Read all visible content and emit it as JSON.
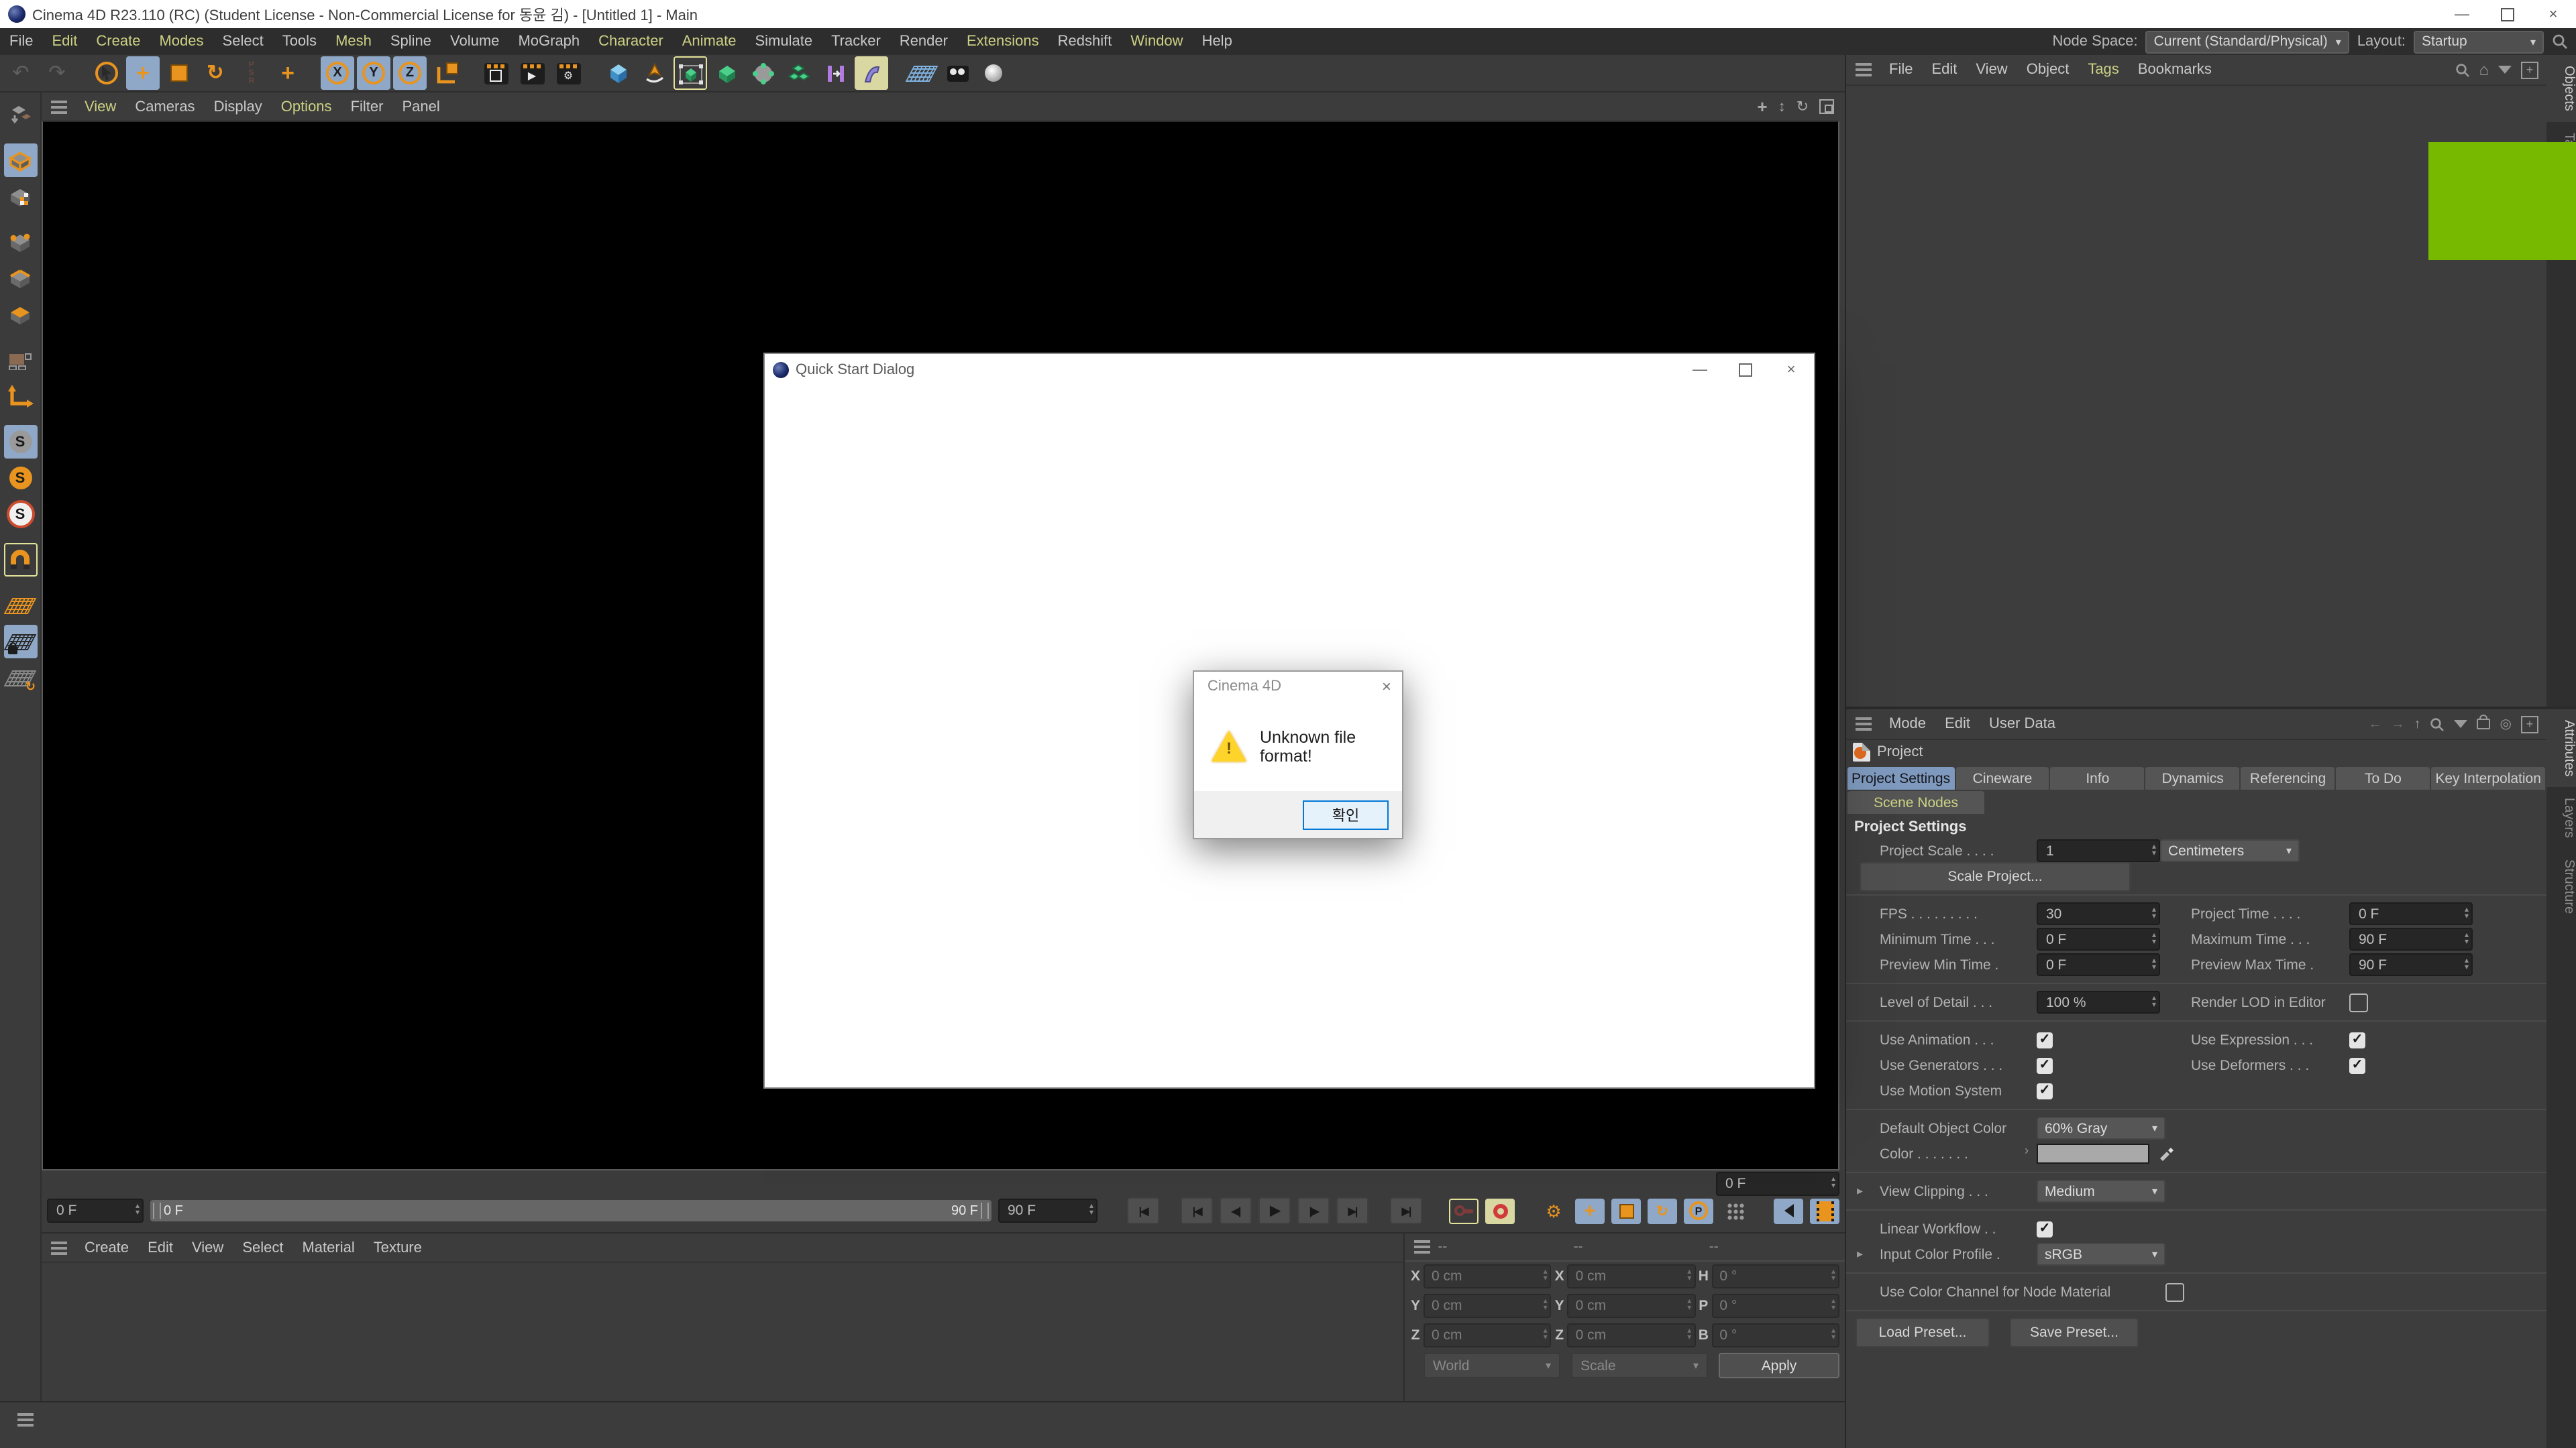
{
  "window": {
    "title": "Cinema 4D R23.110 (RC) (Student License - Non-Commercial License for 동윤 김) - [Untitled 1] - Main",
    "minimize": "—",
    "close": "×"
  },
  "menubar": {
    "items": [
      {
        "label": "File"
      },
      {
        "label": "Edit",
        "tint": true
      },
      {
        "label": "Create",
        "tint": true
      },
      {
        "label": "Modes",
        "tint": true
      },
      {
        "label": "Select"
      },
      {
        "label": "Tools"
      },
      {
        "label": "Mesh",
        "tint": true
      },
      {
        "label": "Spline"
      },
      {
        "label": "Volume"
      },
      {
        "label": "MoGraph"
      },
      {
        "label": "Character",
        "tint": true
      },
      {
        "label": "Animate",
        "tint": true
      },
      {
        "label": "Simulate"
      },
      {
        "label": "Tracker"
      },
      {
        "label": "Render"
      },
      {
        "label": "Extensions",
        "tint": true
      },
      {
        "label": "Redshift"
      },
      {
        "label": "Window",
        "tint": true
      },
      {
        "label": "Help"
      }
    ],
    "node_space_label": "Node Space:",
    "node_space_value": "Current (Standard/Physical)",
    "layout_label": "Layout:",
    "layout_value": "Startup"
  },
  "viewport_menu": {
    "items": [
      {
        "label": "View",
        "tint": true
      },
      {
        "label": "Cameras"
      },
      {
        "label": "Display"
      },
      {
        "label": "Options",
        "tint": true
      },
      {
        "label": "Filter"
      },
      {
        "label": "Panel"
      }
    ]
  },
  "object_manager": {
    "items": [
      {
        "label": "File"
      },
      {
        "label": "Edit"
      },
      {
        "label": "View"
      },
      {
        "label": "Object"
      },
      {
        "label": "Tags",
        "tint": true
      },
      {
        "label": "Bookmarks"
      }
    ],
    "side_tabs": [
      "Objects",
      "Takes"
    ]
  },
  "attributes": {
    "items": [
      {
        "label": "Mode"
      },
      {
        "label": "Edit"
      },
      {
        "label": "User Data"
      }
    ],
    "object_label": "Project",
    "tabs": [
      "Project Settings",
      "Cineware",
      "Info",
      "Dynamics",
      "Referencing",
      "To Do",
      "Key Interpolation"
    ],
    "tabs_row2": [
      "Scene Nodes"
    ],
    "side_tabs": [
      "Attributes",
      "Layers",
      "Structure"
    ],
    "header": "Project Settings",
    "fields": {
      "project_scale": {
        "label": "Project Scale . . . .",
        "value": "1",
        "unit": "Centimeters"
      },
      "scale_project": "Scale Project...",
      "fps": {
        "label": "FPS . . . . . . . . .",
        "value": "30"
      },
      "project_time": {
        "label": "Project Time . . . .",
        "value": "0 F"
      },
      "minimum_time": {
        "label": "Minimum Time . . .",
        "value": "0 F"
      },
      "maximum_time": {
        "label": "Maximum Time . . .",
        "value": "90 F"
      },
      "preview_min_time": {
        "label": "Preview Min Time .",
        "value": "0 F"
      },
      "preview_max_time": {
        "label": "Preview Max Time .",
        "value": "90 F"
      },
      "level_of_detail": {
        "label": "Level of Detail . . .",
        "value": "100 %"
      },
      "render_lod": {
        "label": "Render LOD in Editor",
        "checked": false
      },
      "use_animation": {
        "label": "Use Animation . . .",
        "checked": true
      },
      "use_expression": {
        "label": "Use Expression . . .",
        "checked": true
      },
      "use_generators": {
        "label": "Use Generators . . .",
        "checked": true
      },
      "use_deformers": {
        "label": "Use Deformers . . .",
        "checked": true
      },
      "use_motion_system": {
        "label": "Use Motion System",
        "checked": true
      },
      "default_object_color": {
        "label": "Default Object Color",
        "value": "60% Gray"
      },
      "color": {
        "label": "Color . . . . . . .",
        "swatch": "#a9a9a9"
      },
      "view_clipping": {
        "label": "View Clipping . . .",
        "value": "Medium"
      },
      "linear_workflow": {
        "label": "Linear Workflow . .",
        "checked": true
      },
      "input_color_profile": {
        "label": "Input Color Profile .",
        "value": "sRGB"
      },
      "use_color_channel": {
        "label": "Use Color Channel for Node Material",
        "checked": false
      },
      "load_preset": "Load Preset...",
      "save_preset": "Save Preset..."
    }
  },
  "timeline": {
    "current_frame": "0 F",
    "start": "0 F",
    "end": "90 F",
    "range_start": "0 F",
    "range_end": "90 F"
  },
  "material_manager": {
    "items": [
      {
        "label": "Create"
      },
      {
        "label": "Edit"
      },
      {
        "label": "View"
      },
      {
        "label": "Select"
      },
      {
        "label": "Material"
      },
      {
        "label": "Texture"
      }
    ]
  },
  "coordinates": {
    "headers": [
      "--",
      "--",
      "--"
    ],
    "position": {
      "x_label": "X",
      "x": "0 cm",
      "y_label": "Y",
      "y": "0 cm",
      "z_label": "Z",
      "z": "0 cm",
      "space": "World"
    },
    "scale": {
      "x_label": "X",
      "x": "0 cm",
      "y_label": "Y",
      "y": "0 cm",
      "z_label": "Z",
      "z": "0 cm",
      "mode": "Scale"
    },
    "rotation": {
      "h_label": "H",
      "h": "0 °",
      "p_label": "P",
      "p": "0 °",
      "b_label": "B",
      "b": "0 °",
      "apply": "Apply"
    }
  },
  "quick_start": {
    "title": "Quick Start Dialog"
  },
  "modal": {
    "title": "Cinema 4D",
    "message": "Unknown file format!",
    "ok": "확인"
  },
  "colors": {
    "accent_green": "#77b800",
    "active_blue": "#8fa8c8",
    "highlight_yellow": "#e3e29a",
    "orange": "#e8941e"
  }
}
